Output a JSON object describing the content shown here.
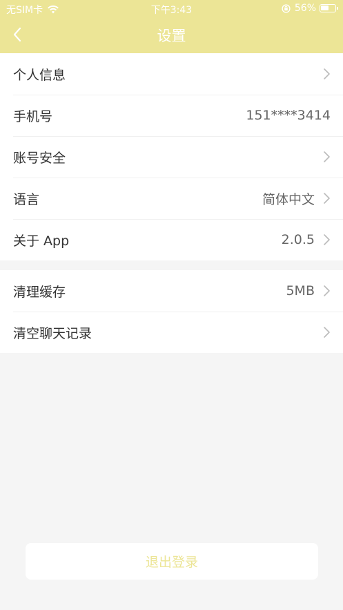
{
  "status_bar": {
    "carrier": "无SIM卡",
    "time": "下午3:43",
    "battery": "56%",
    "battery_level": 0.56
  },
  "nav": {
    "title": "设置",
    "back_icon": "chevron-left-icon"
  },
  "groups": [
    {
      "items": [
        {
          "label": "个人信息",
          "value": ""
        },
        {
          "label": "手机号",
          "value": "151****3414"
        },
        {
          "label": "账号安全",
          "value": ""
        },
        {
          "label": "语言",
          "value": "简体中文"
        },
        {
          "label": "关于 App",
          "value": "2.0.5"
        }
      ]
    },
    {
      "items": [
        {
          "label": "清理缓存",
          "value": "5MB"
        },
        {
          "label": "清空聊天记录",
          "value": ""
        }
      ]
    }
  ],
  "logout": {
    "label": "退出登录"
  },
  "colors": {
    "accent": "#ece596",
    "background": "#f5f5f5",
    "text": "#333333",
    "secondary_text": "#666666",
    "chevron": "#bbbbbb"
  }
}
